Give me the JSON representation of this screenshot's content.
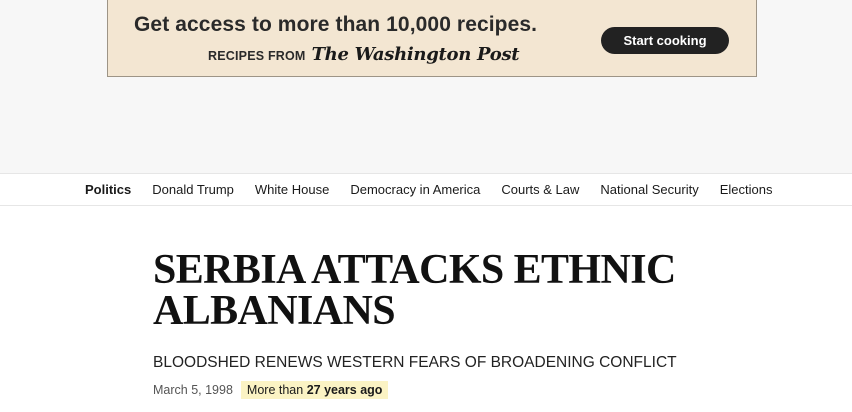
{
  "ad": {
    "headline": "Get access to more than 10,000 recipes.",
    "subline": "RECIPES FROM",
    "logo_text": "The Washington Post",
    "cta_label": "Start cooking",
    "colors": {
      "banner_bg": "#f3e6d2",
      "cta_bg": "#222222",
      "cta_text": "#ffffff"
    }
  },
  "nav": {
    "items": [
      {
        "label": "Politics",
        "active": true
      },
      {
        "label": "Donald Trump",
        "active": false
      },
      {
        "label": "White House",
        "active": false
      },
      {
        "label": "Democracy in America",
        "active": false
      },
      {
        "label": "Courts & Law",
        "active": false
      },
      {
        "label": "National Security",
        "active": false
      },
      {
        "label": "Elections",
        "active": false
      }
    ]
  },
  "article": {
    "headline": "SERBIA ATTACKS ETHNIC ALBANIANS",
    "subhead": "BLOODSHED RENEWS WESTERN FEARS OF BROADENING CONFLICT",
    "date": "March 5, 1998",
    "age_prefix": "More than",
    "age_value": "27 years ago",
    "colors": {
      "age_badge_bg": "#fbf3c4"
    }
  }
}
